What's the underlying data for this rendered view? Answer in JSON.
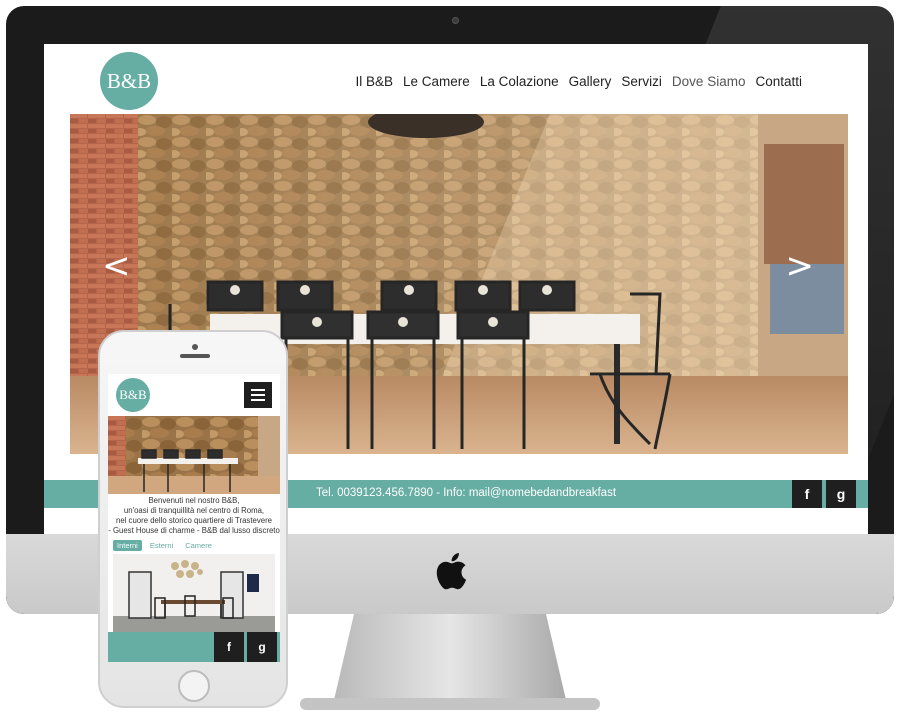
{
  "brand": {
    "logo_text": "B&B",
    "accent_color": "#66ada3"
  },
  "desktop": {
    "nav": [
      "Il B&B",
      "Le Camere",
      "La Colazione",
      "Gallery",
      "Servizi",
      "Dove Siamo",
      "Contatti"
    ],
    "slider": {
      "prev_label": "<",
      "next_label": ">"
    },
    "footer": {
      "contact": "Tel. 0039123.456.7890 - Info: mail@nomebedandbreakfast",
      "facebook_glyph": "f",
      "google_glyph": "g"
    }
  },
  "mobile": {
    "welcome": [
      "Benvenuti nel nostro B&B,",
      "un'oasi di tranquillità nel centro di Roma,",
      "nel cuore dello storico quartiere di Trastevere",
      "- Guest House di charme - B&B dal lusso discreto"
    ],
    "tabs": [
      "Interni",
      "Esterni",
      "Camere"
    ],
    "active_tab": "Interni",
    "facebook_glyph": "f",
    "google_glyph": "g"
  },
  "icons": {
    "menu": "hamburger-icon",
    "facebook": "facebook-icon",
    "google": "google-icon",
    "apple": "apple-logo-icon"
  }
}
